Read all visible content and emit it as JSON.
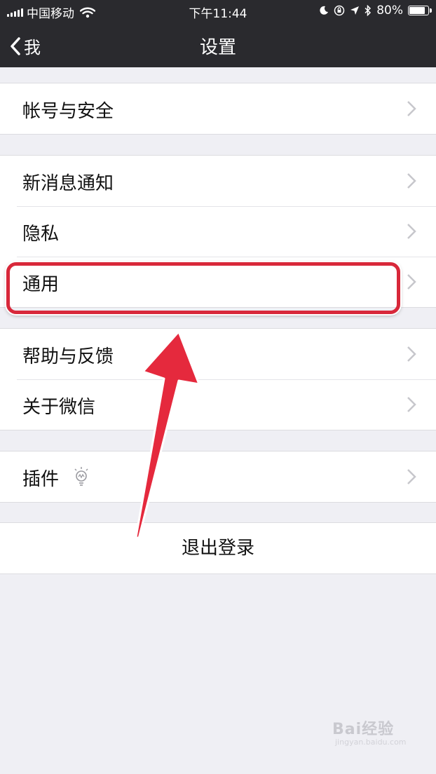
{
  "status_bar": {
    "carrier": "中国移动",
    "time": "下午11:44",
    "battery": "80%",
    "battery_level": 0.8
  },
  "nav": {
    "back_label": "我",
    "title": "设置"
  },
  "groups": {
    "account": {
      "items": [
        {
          "label": "帐号与安全"
        }
      ]
    },
    "notify": {
      "items": [
        {
          "label": "新消息通知"
        },
        {
          "label": "隐私"
        },
        {
          "label": "通用"
        }
      ]
    },
    "about": {
      "items": [
        {
          "label": "帮助与反馈"
        },
        {
          "label": "关于微信"
        }
      ]
    },
    "plugins": {
      "items": [
        {
          "label": "插件",
          "icon": "lightbulb-icon"
        }
      ]
    }
  },
  "logout_label": "退出登录",
  "annotation": {
    "highlighted_item": "通用",
    "color": "#d8283a"
  },
  "watermark": {
    "brand": "Bai经验",
    "url": "jingyan.baidu.com"
  },
  "colors": {
    "nav_bg": "#2a2a2e",
    "page_bg": "#efeff4",
    "chevron": "#c7c7cc"
  }
}
